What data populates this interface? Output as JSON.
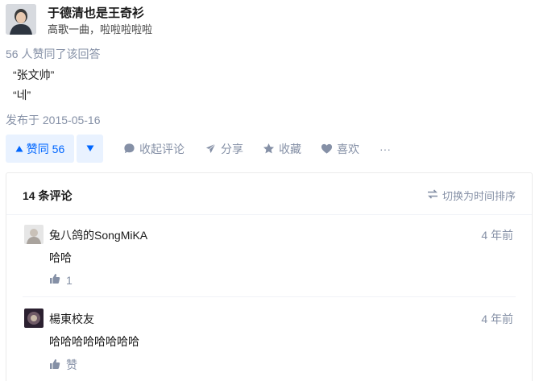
{
  "author": {
    "name": "于德清也是王奇衫",
    "bio": "高歌一曲，啦啦啦啦啦",
    "avatar_icon": "user-avatar"
  },
  "votes_line": "56 人赞同了该回答",
  "answer": {
    "lines": [
      "“张文帅”",
      "“네”"
    ]
  },
  "published": "发布于 2015-05-16",
  "actions": {
    "upvote_label": "赞同 56",
    "comments_label": "收起评论",
    "share_label": "分享",
    "collect_label": "收藏",
    "like_label": "喜欢",
    "more_label": "···"
  },
  "comments": {
    "title": "14 条评论",
    "sort_label": "切换为时间排序",
    "items": [
      {
        "author": "兔八鸽的SongMiKA",
        "time": "4 年前",
        "text": "哈哈",
        "likes": "1"
      },
      {
        "author": "楊東校友",
        "time": "4 年前",
        "text": "哈哈哈哈哈哈哈哈",
        "likes": "赞"
      }
    ]
  },
  "colors": {
    "accent": "#0066ff",
    "accent_bg": "#e9f2ff",
    "muted": "#8590a6"
  }
}
